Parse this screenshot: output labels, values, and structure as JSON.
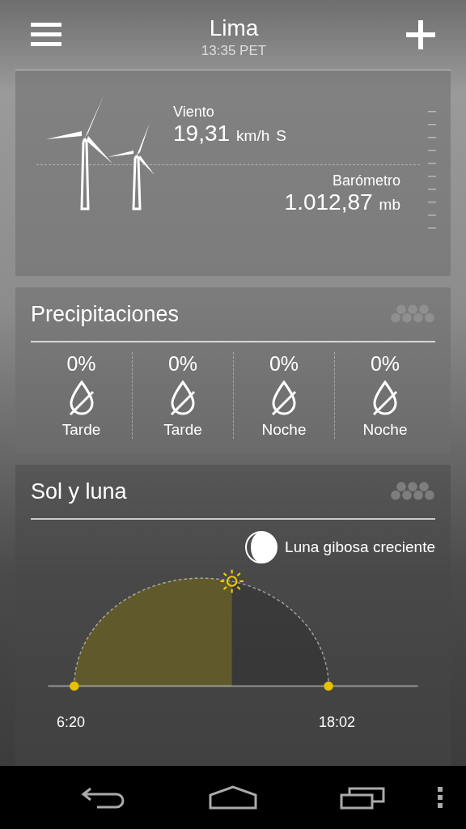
{
  "header": {
    "city": "Lima",
    "time": "13:35 PET"
  },
  "wind_card": {
    "wind_label": "Viento",
    "wind_value": "19,31",
    "wind_unit": "km/h",
    "wind_direction": "S",
    "barometer_label": "Barómetro",
    "barometer_value": "1.012,87",
    "barometer_unit": "mb"
  },
  "precipitation": {
    "title": "Precipitaciones",
    "periods": [
      {
        "chance": "0%",
        "label": "Tarde"
      },
      {
        "chance": "0%",
        "label": "Tarde"
      },
      {
        "chance": "0%",
        "label": "Noche"
      },
      {
        "chance": "0%",
        "label": "Noche"
      }
    ]
  },
  "sun_moon": {
    "title": "Sol y luna",
    "moon_phase": "Luna gibosa creciente",
    "sunrise": "6:20",
    "sunset": "18:02",
    "level": 0.62
  }
}
